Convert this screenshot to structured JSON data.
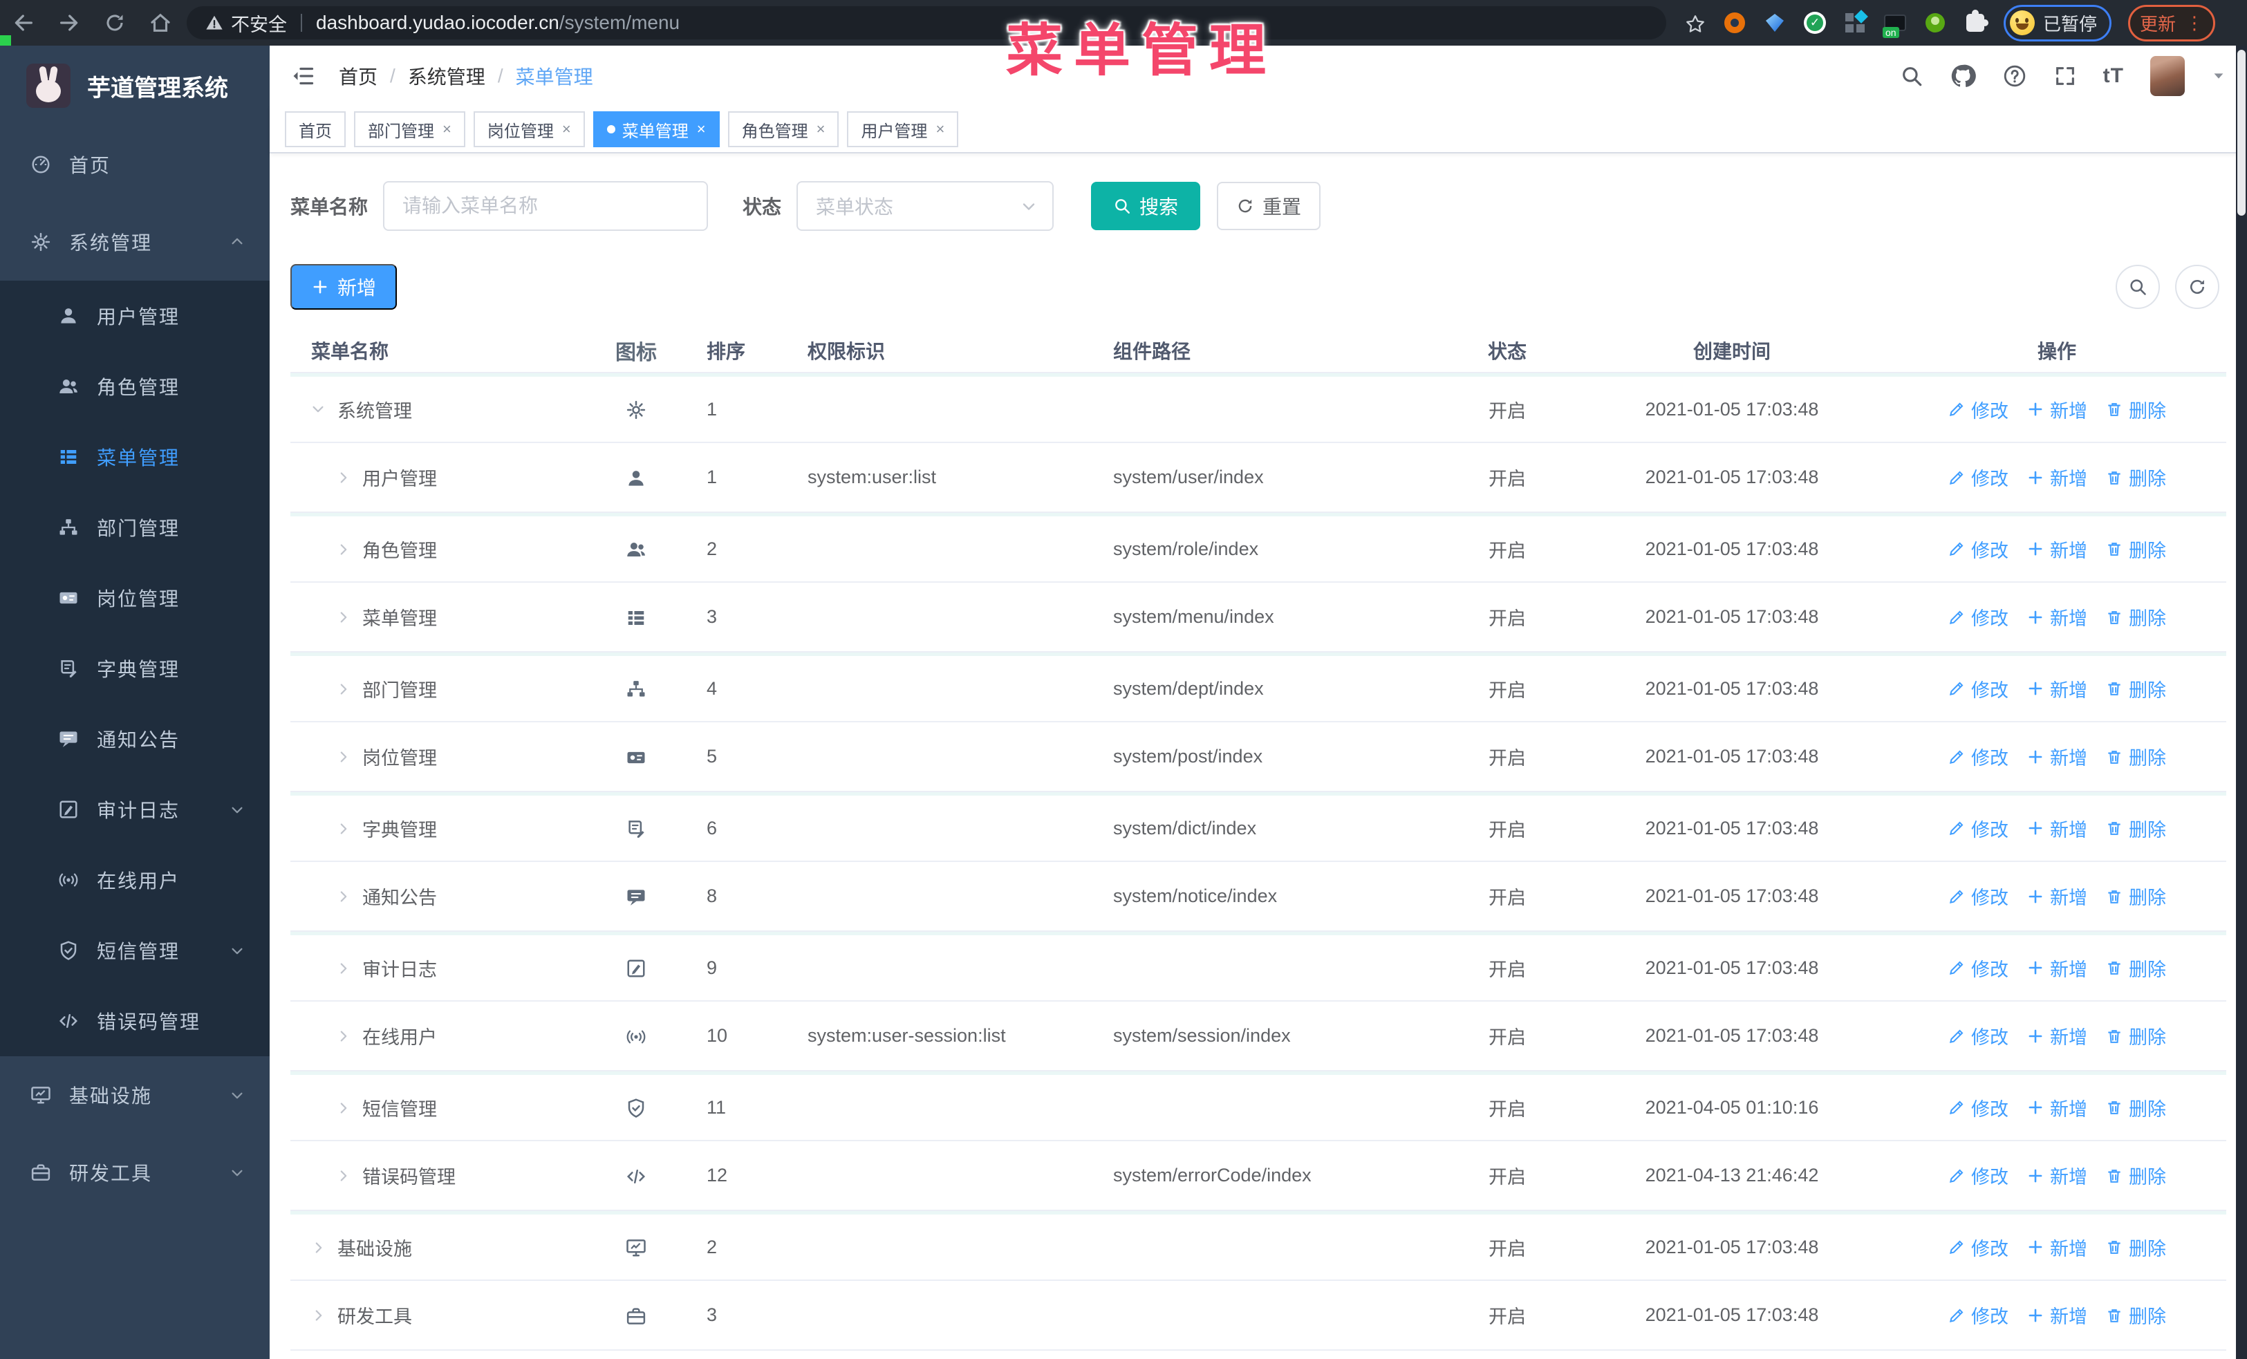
{
  "colors": {
    "accent": "#409EFF",
    "search_button": "#0db3a6",
    "watermark": "#f4466b",
    "sidebar_bg": "#304156",
    "submenu_bg": "#1f2d3d"
  },
  "browser": {
    "security_label": "不安全",
    "url_host": "dashboard.yudao.iocoder.cn",
    "url_path": "/system/menu",
    "paused_badge_label": "已暂停",
    "update_button_label": "更新",
    "nav_icons": [
      "back",
      "forward",
      "reload",
      "home"
    ],
    "extension_icons": [
      "bookmark-star",
      "donut",
      "gem",
      "check-circle",
      "grid-diamond",
      "server-on",
      "person",
      "puzzle"
    ]
  },
  "watermark_text": "菜单管理",
  "sidebar": {
    "logo_title": "芋道管理系统",
    "items": [
      {
        "label": "首页",
        "icon": "dashboard",
        "level": 0,
        "chevron": ""
      },
      {
        "label": "系统管理",
        "icon": "gear",
        "level": 0,
        "chevron": "up"
      },
      {
        "label": "用户管理",
        "icon": "user",
        "level": 1,
        "chevron": ""
      },
      {
        "label": "角色管理",
        "icon": "users",
        "level": 1,
        "chevron": ""
      },
      {
        "label": "菜单管理",
        "icon": "menu-list",
        "level": 1,
        "chevron": "",
        "active": true
      },
      {
        "label": "部门管理",
        "icon": "tree",
        "level": 1,
        "chevron": ""
      },
      {
        "label": "岗位管理",
        "icon": "badge",
        "level": 1,
        "chevron": ""
      },
      {
        "label": "字典管理",
        "icon": "dict",
        "level": 1,
        "chevron": ""
      },
      {
        "label": "通知公告",
        "icon": "message",
        "level": 1,
        "chevron": ""
      },
      {
        "label": "审计日志",
        "icon": "log",
        "level": 1,
        "chevron": "down"
      },
      {
        "label": "在线用户",
        "icon": "online",
        "level": 1,
        "chevron": ""
      },
      {
        "label": "短信管理",
        "icon": "shield",
        "level": 1,
        "chevron": "down"
      },
      {
        "label": "错误码管理",
        "icon": "code",
        "level": 1,
        "chevron": ""
      },
      {
        "label": "基础设施",
        "icon": "monitor",
        "level": 0,
        "chevron": "down"
      },
      {
        "label": "研发工具",
        "icon": "toolbox",
        "level": 0,
        "chevron": "down"
      }
    ]
  },
  "header": {
    "breadcrumb": [
      "首页",
      "系统管理",
      "菜单管理"
    ],
    "icons": [
      "search",
      "github",
      "question",
      "fullscreen",
      "font-size"
    ],
    "font_size_glyph": "tT"
  },
  "tabs": [
    {
      "label": "首页",
      "closable": false,
      "active": false
    },
    {
      "label": "部门管理",
      "closable": true,
      "active": false
    },
    {
      "label": "岗位管理",
      "closable": true,
      "active": false
    },
    {
      "label": "菜单管理",
      "closable": true,
      "active": true
    },
    {
      "label": "角色管理",
      "closable": true,
      "active": false
    },
    {
      "label": "用户管理",
      "closable": true,
      "active": false
    }
  ],
  "filters": {
    "name_label": "菜单名称",
    "name_placeholder": "请输入菜单名称",
    "name_value": "",
    "status_label": "状态",
    "status_placeholder": "菜单状态",
    "search_label": "搜索",
    "reset_label": "重置"
  },
  "toolbar": {
    "add_label": "新增"
  },
  "table": {
    "columns": [
      "菜单名称",
      "图标",
      "排序",
      "权限标识",
      "组件路径",
      "状态",
      "创建时间",
      "操作"
    ],
    "ops": [
      "修改",
      "新增",
      "删除"
    ],
    "rows": [
      {
        "name": "系统管理",
        "icon": "gear",
        "sort": "1",
        "perm": "",
        "path": "",
        "status": "开启",
        "created": "2021-01-05 17:03:48",
        "level": 0,
        "expanded": true
      },
      {
        "name": "用户管理",
        "icon": "user",
        "sort": "1",
        "perm": "system:user:list",
        "path": "system/user/index",
        "status": "开启",
        "created": "2021-01-05 17:03:48",
        "level": 1
      },
      {
        "name": "角色管理",
        "icon": "users",
        "sort": "2",
        "perm": "",
        "path": "system/role/index",
        "status": "开启",
        "created": "2021-01-05 17:03:48",
        "level": 1
      },
      {
        "name": "菜单管理",
        "icon": "menu-list",
        "sort": "3",
        "perm": "",
        "path": "system/menu/index",
        "status": "开启",
        "created": "2021-01-05 17:03:48",
        "level": 1
      },
      {
        "name": "部门管理",
        "icon": "tree",
        "sort": "4",
        "perm": "",
        "path": "system/dept/index",
        "status": "开启",
        "created": "2021-01-05 17:03:48",
        "level": 1
      },
      {
        "name": "岗位管理",
        "icon": "badge",
        "sort": "5",
        "perm": "",
        "path": "system/post/index",
        "status": "开启",
        "created": "2021-01-05 17:03:48",
        "level": 1
      },
      {
        "name": "字典管理",
        "icon": "dict",
        "sort": "6",
        "perm": "",
        "path": "system/dict/index",
        "status": "开启",
        "created": "2021-01-05 17:03:48",
        "level": 1
      },
      {
        "name": "通知公告",
        "icon": "message",
        "sort": "8",
        "perm": "",
        "path": "system/notice/index",
        "status": "开启",
        "created": "2021-01-05 17:03:48",
        "level": 1
      },
      {
        "name": "审计日志",
        "icon": "log",
        "sort": "9",
        "perm": "",
        "path": "",
        "status": "开启",
        "created": "2021-01-05 17:03:48",
        "level": 1
      },
      {
        "name": "在线用户",
        "icon": "online",
        "sort": "10",
        "perm": "system:user-session:list",
        "path": "system/session/index",
        "status": "开启",
        "created": "2021-01-05 17:03:48",
        "level": 1
      },
      {
        "name": "短信管理",
        "icon": "shield",
        "sort": "11",
        "perm": "",
        "path": "",
        "status": "开启",
        "created": "2021-04-05 01:10:16",
        "level": 1
      },
      {
        "name": "错误码管理",
        "icon": "code",
        "sort": "12",
        "perm": "",
        "path": "system/errorCode/index",
        "status": "开启",
        "created": "2021-04-13 21:46:42",
        "level": 1
      },
      {
        "name": "基础设施",
        "icon": "monitor",
        "sort": "2",
        "perm": "",
        "path": "",
        "status": "开启",
        "created": "2021-01-05 17:03:48",
        "level": 0
      },
      {
        "name": "研发工具",
        "icon": "toolbox",
        "sort": "3",
        "perm": "",
        "path": "",
        "status": "开启",
        "created": "2021-01-05 17:03:48",
        "level": 0
      }
    ]
  }
}
